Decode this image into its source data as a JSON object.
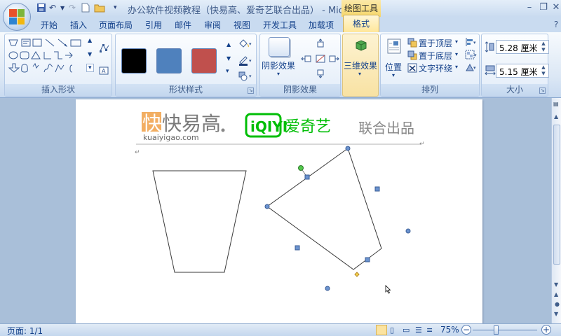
{
  "window": {
    "title": "办公软件视频教程（快易高、爱奇艺联合出品） - Micr...",
    "context_tab": "绘图工具"
  },
  "tabs": [
    "开始",
    "插入",
    "页面布局",
    "引用",
    "邮件",
    "审阅",
    "视图",
    "开发工具",
    "加载项"
  ],
  "active_tab": "格式",
  "ribbon": {
    "groups": {
      "insert_shapes": "插入形状",
      "shape_styles": "形状样式",
      "shadow_effects": "阴影效果",
      "arrange": "排列",
      "size": "大小"
    },
    "shadow_button": "阴影效果",
    "threed_button": "三维效果",
    "position_button": "位置",
    "bring_to_front": "置于顶层",
    "send_to_back": "置于底层",
    "text_wrap": "文字环绕",
    "height_value": "5.28 厘米",
    "width_value": "5.15 厘米"
  },
  "colors": {
    "swatch_black": "#000000",
    "swatch_blue": "#4f81bd",
    "swatch_red": "#c0504d",
    "accent_brand_green": "#00be06"
  },
  "document": {
    "header_logo_main": "快易高",
    "header_logo_sub": "kuaiyigao.com",
    "iqiyi_logo": "iQIYI",
    "iqiyi_cn": "爱奇艺",
    "joint_text": "联合出品"
  },
  "status": {
    "page": "页面: 1/1",
    "zoom": "75%"
  }
}
